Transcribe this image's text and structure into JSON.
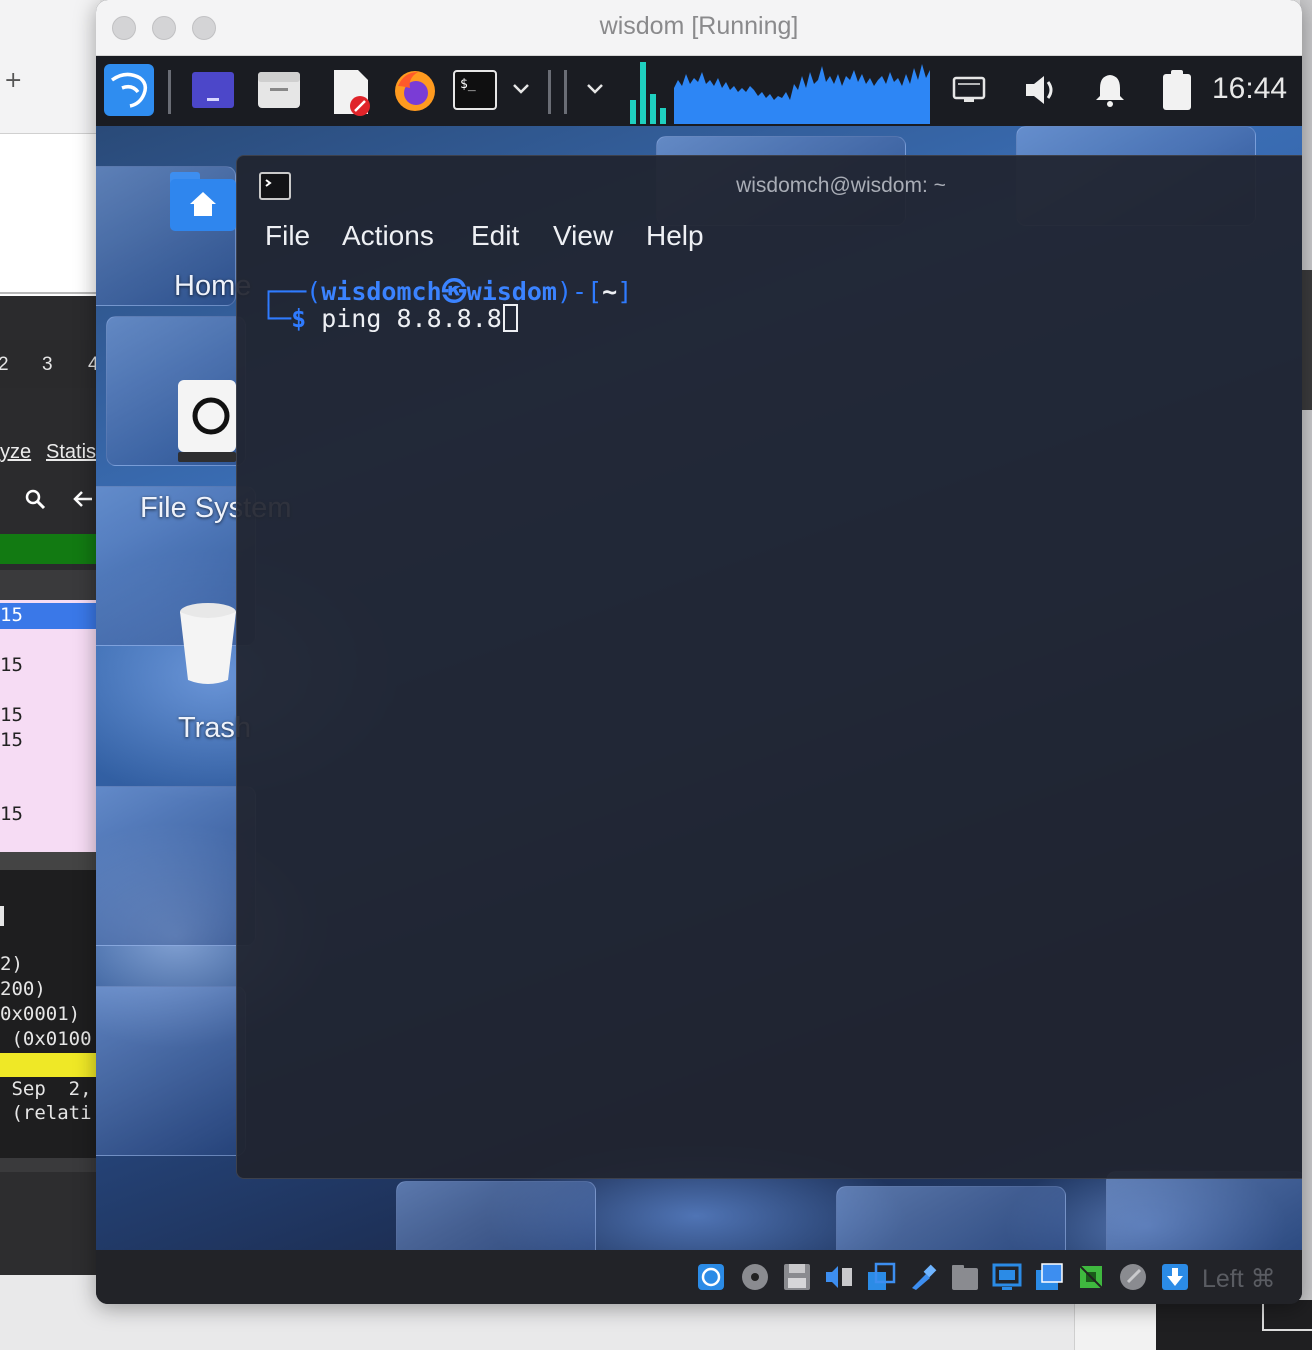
{
  "background_app": {
    "tab_plus": "+",
    "tabs": [
      "2",
      "3",
      "4"
    ],
    "menu": [
      "yze",
      "Statis"
    ],
    "rows": [
      "15",
      "15",
      "15",
      "15",
      "15"
    ],
    "details": [
      "2)",
      "200)",
      "0x0001)",
      " (0x0100",
      " Sep  2,",
      " (relati"
    ]
  },
  "vm_window": {
    "title": "wisdom [Running]"
  },
  "panel": {
    "clock": "16:44",
    "icons": [
      "kali-menu-icon",
      "workspace-icon",
      "file-manager-icon",
      "text-editor-icon",
      "firefox-icon",
      "terminal-icon",
      "chevron-down-icon",
      "chevron-down-icon",
      "network-icon",
      "volume-icon",
      "notification-bell-icon",
      "clipboard-icon"
    ]
  },
  "desktop_icons": [
    {
      "label": "Home",
      "icon": "home-folder-icon"
    },
    {
      "label": "File System",
      "icon": "drive-icon"
    },
    {
      "label": "Trash",
      "icon": "trash-icon"
    }
  ],
  "terminal": {
    "title": "wisdomch@wisdom: ~",
    "menu": [
      "File",
      "Actions",
      "Edit",
      "View",
      "Help"
    ],
    "prompt_line1_a": "┌──(",
    "user": "wisdomch",
    "at_symbol": "㉿",
    "host": "wisdom",
    "prompt_line1_b": ")-[",
    "cwd": "~",
    "prompt_line1_c": "]",
    "prompt_line2": "└─$",
    "command": " ping 8.8.8.8"
  },
  "statusbar": {
    "host_key": "Left ⌘",
    "icons": [
      "hard-disk-icon",
      "optical-disk-icon",
      "floppy-icon",
      "audio-icon",
      "network-adapters-icon",
      "usb-icon",
      "shared-folders-icon",
      "display-icon",
      "recording-icon",
      "cpu-icon",
      "mouse-integration-icon",
      "host-key-icon"
    ]
  }
}
